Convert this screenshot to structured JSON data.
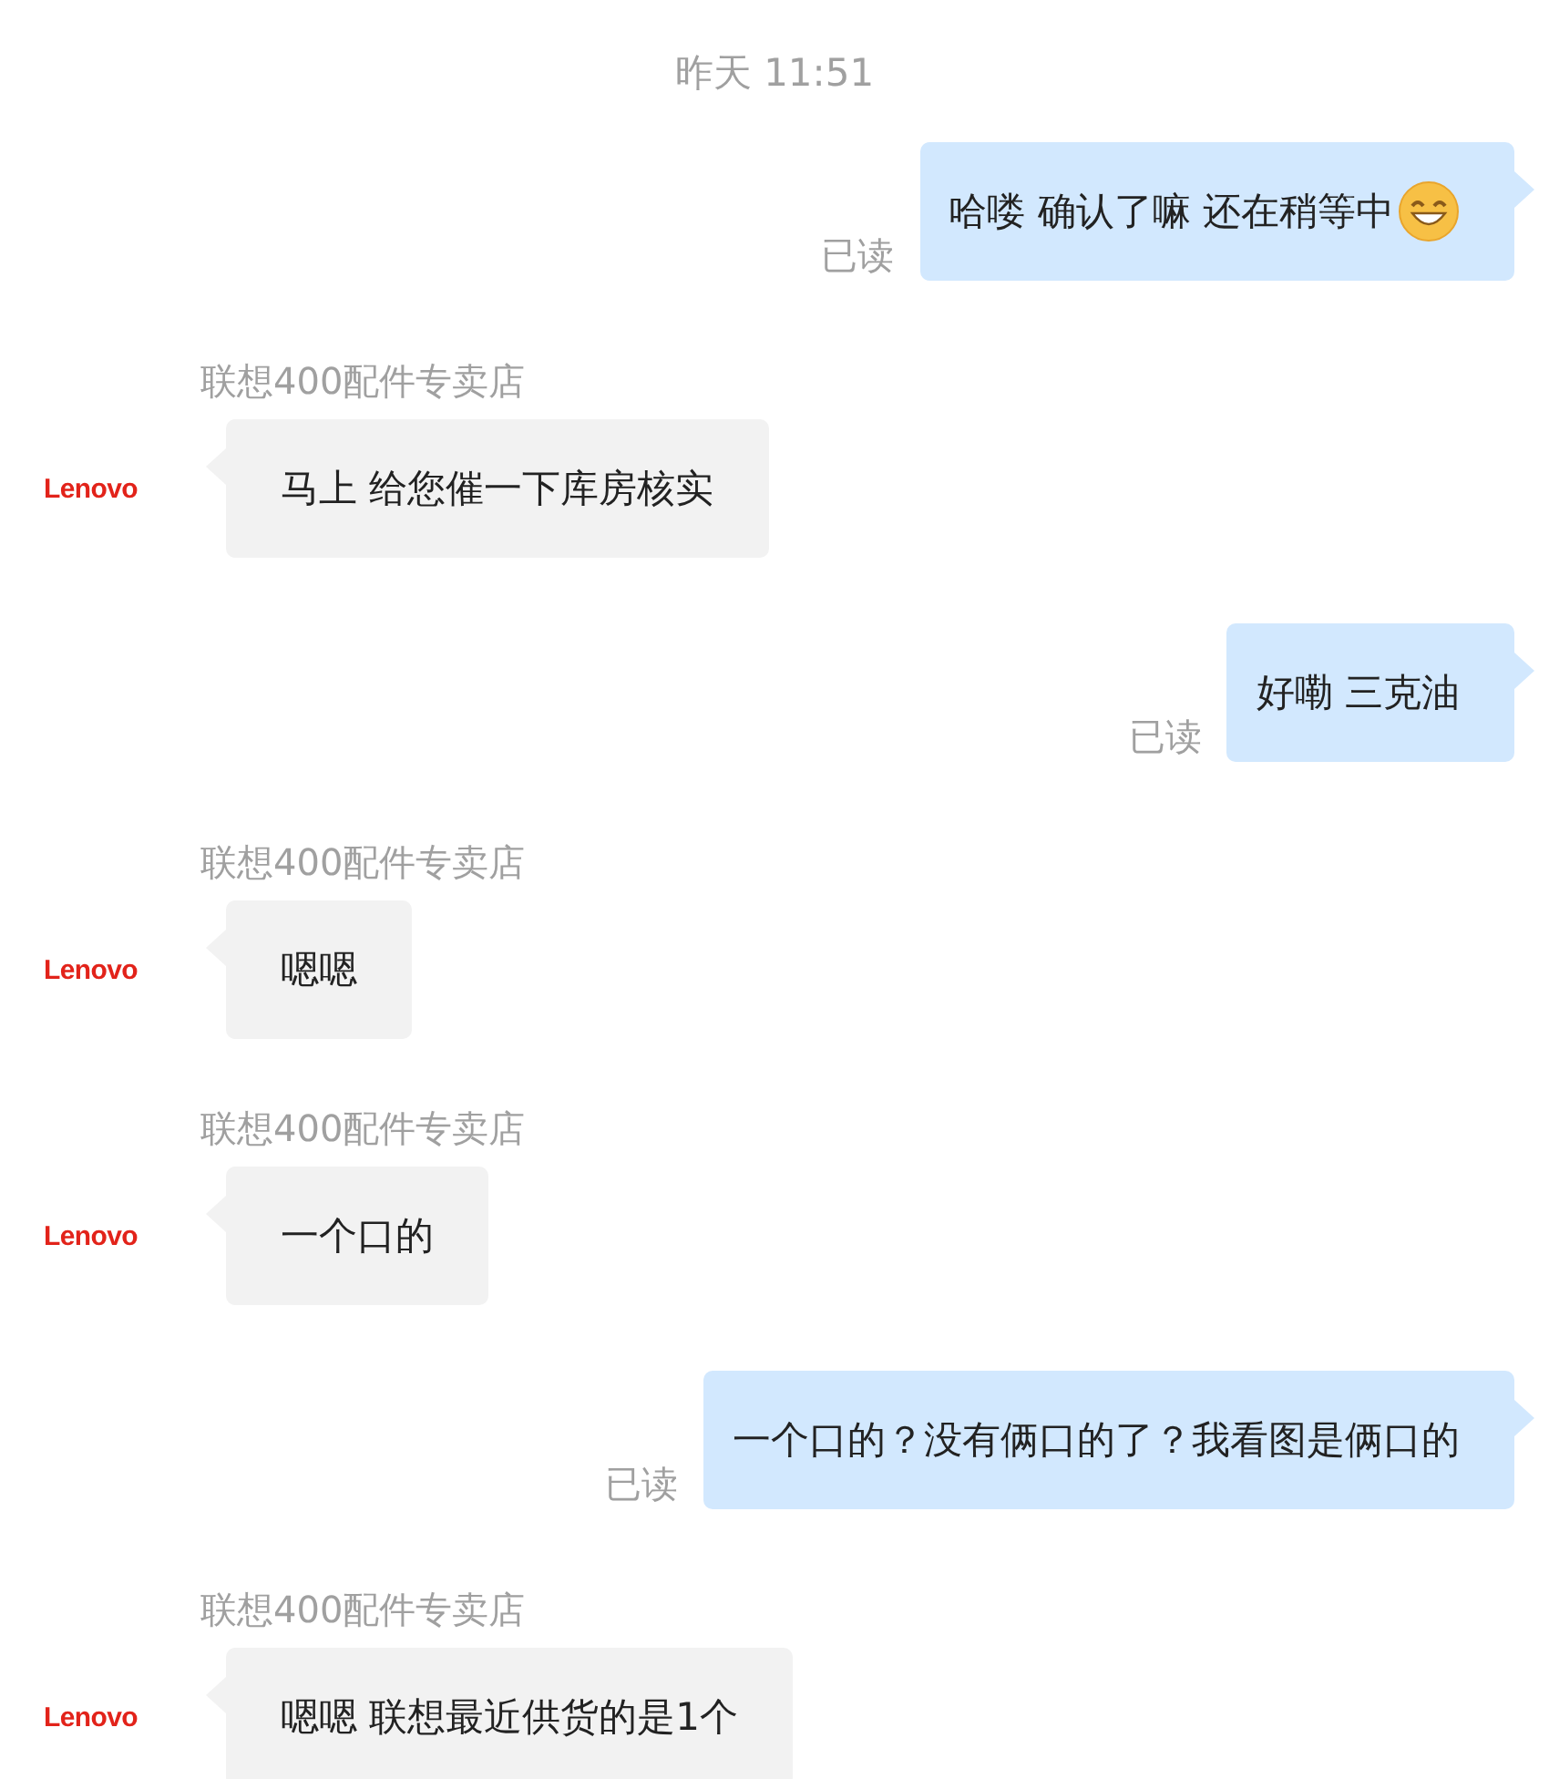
{
  "messages": [
    {
      "kind": "time",
      "text": "昨天 11:51"
    },
    {
      "kind": "sent",
      "text": "哈喽 确认了嘛 还在稍等中",
      "emoji": true,
      "status": "已读"
    },
    {
      "kind": "received",
      "sender": "联想400配件专卖店",
      "avatar": "Lenovo",
      "text": "马上 给您催一下库房核实"
    },
    {
      "kind": "sent",
      "text": "好嘞 三克油",
      "emoji": false,
      "status": "已读"
    },
    {
      "kind": "received",
      "sender": "联想400配件专卖店",
      "avatar": "Lenovo",
      "text": "嗯嗯"
    },
    {
      "kind": "received",
      "sender": "联想400配件专卖店",
      "avatar": "Lenovo",
      "text": "一个口的"
    },
    {
      "kind": "sent",
      "text": "一个口的？没有俩口的了？我看图是俩口的",
      "emoji": false,
      "status": "已读"
    },
    {
      "kind": "received",
      "sender": "联想400配件专卖店",
      "avatar": "Lenovo",
      "text": "嗯嗯 联想最近供货的是1个"
    }
  ]
}
